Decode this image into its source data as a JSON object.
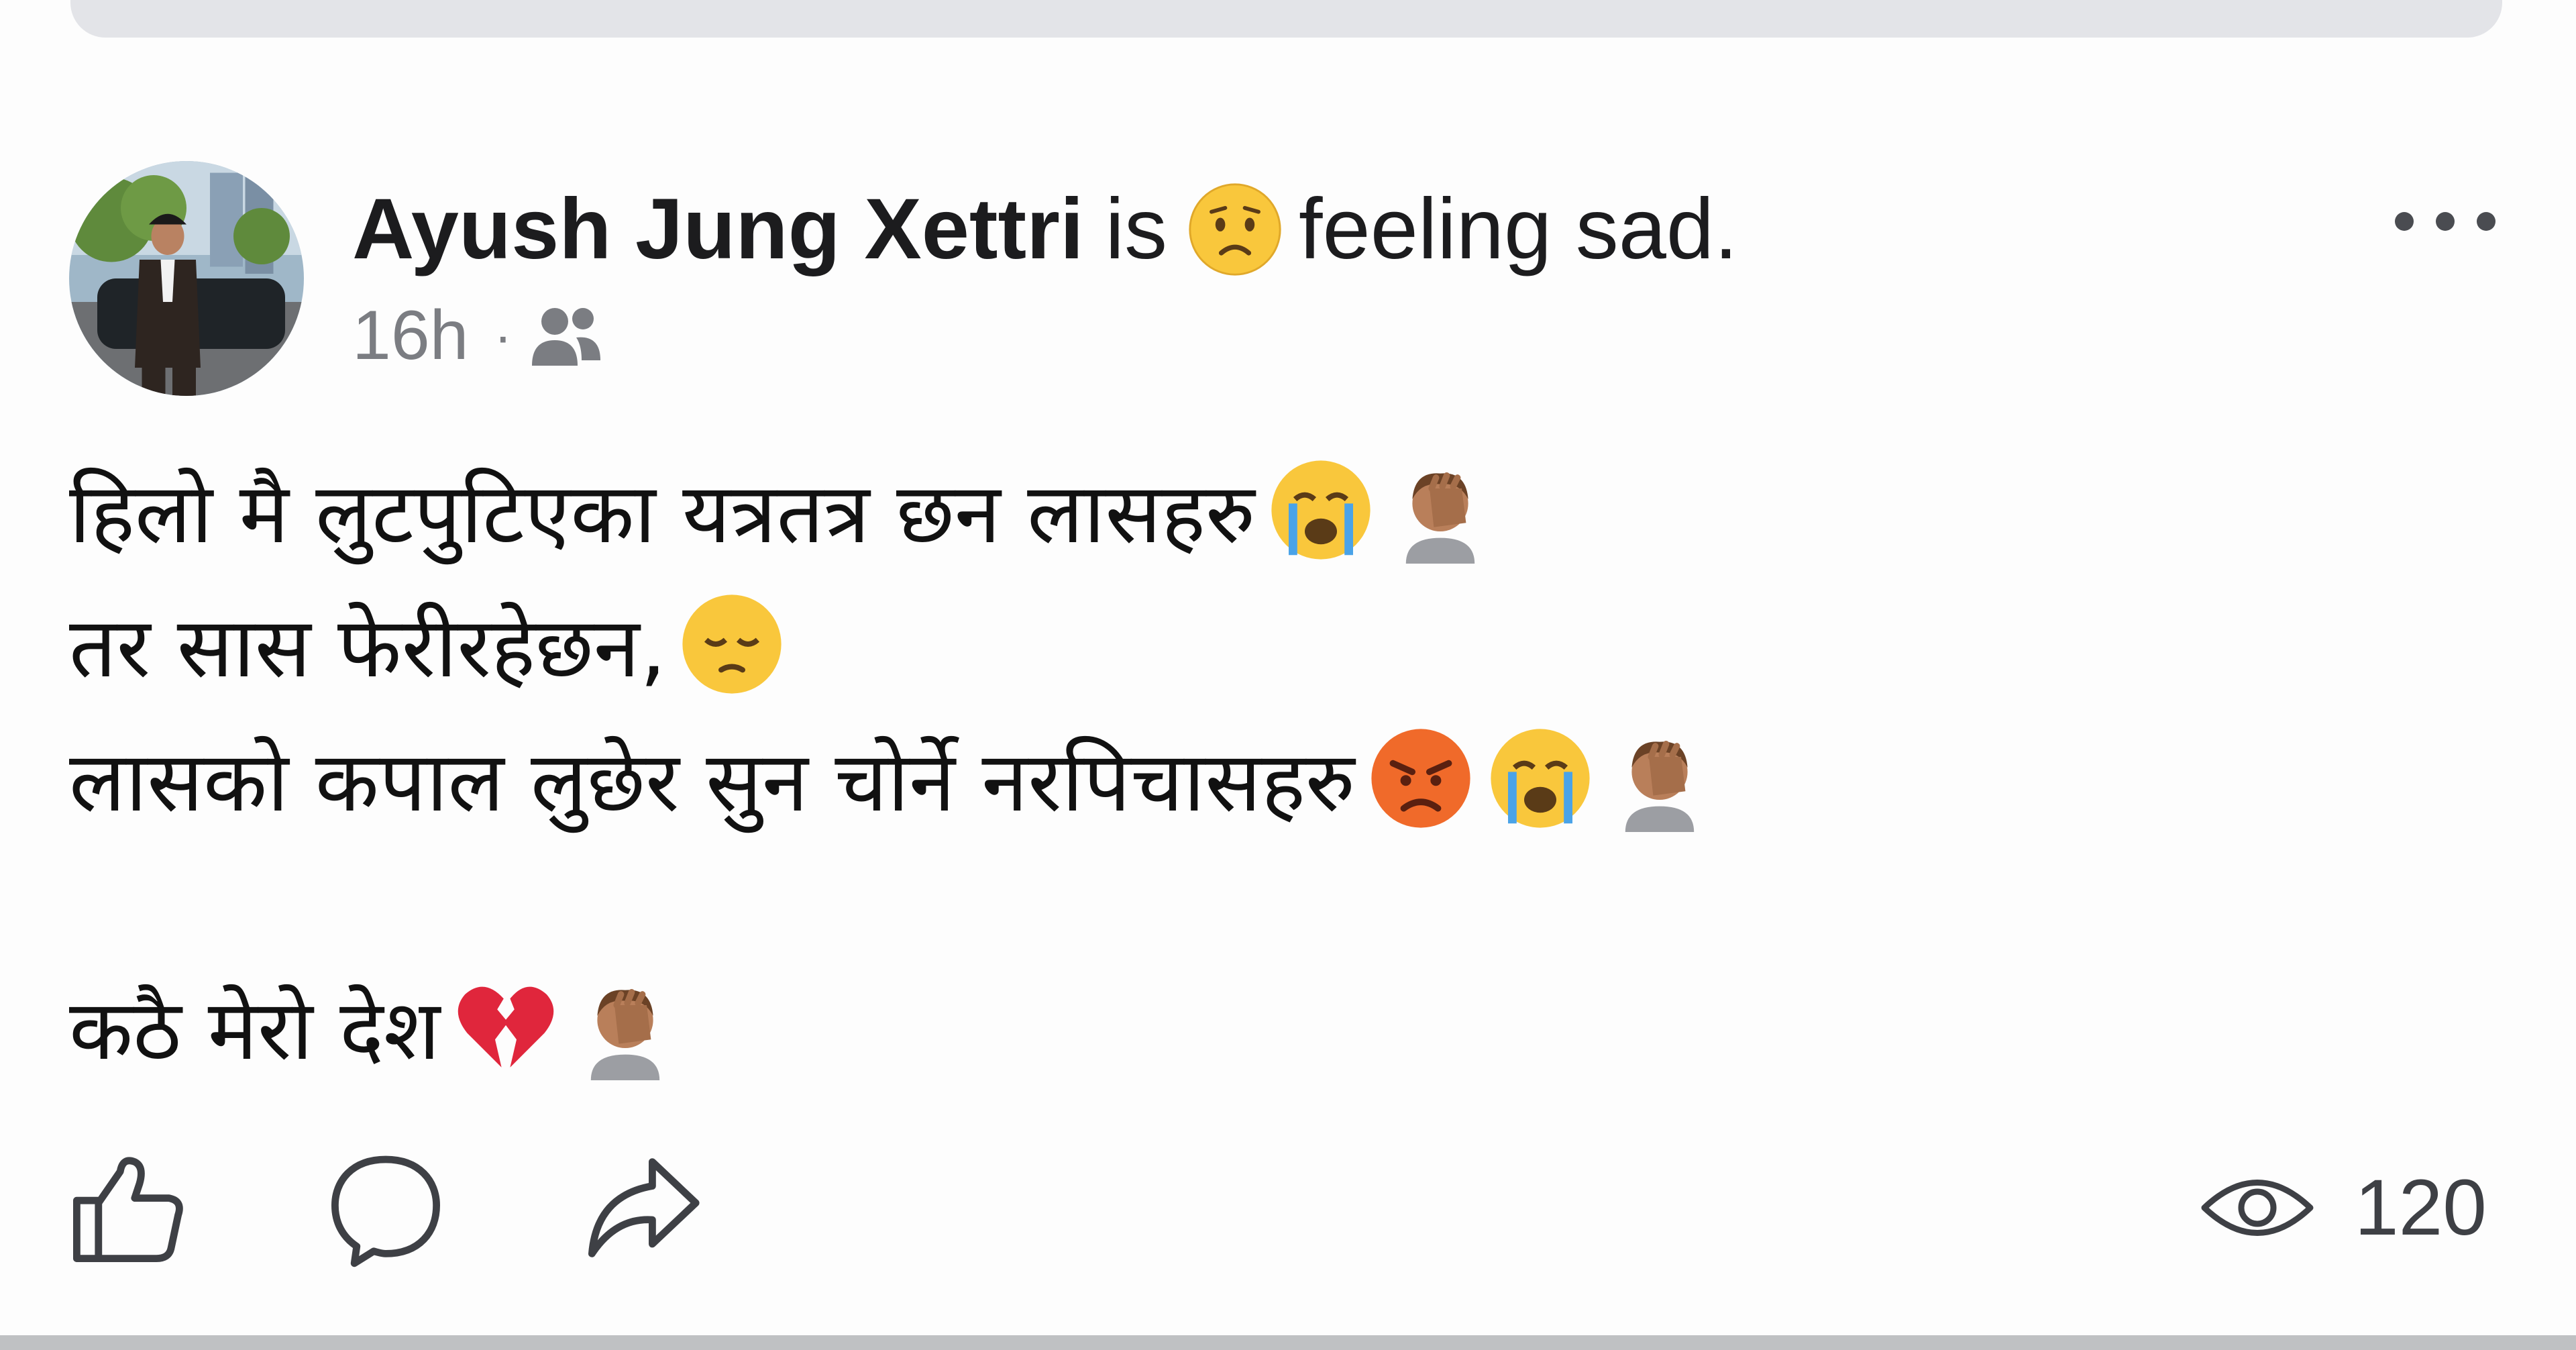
{
  "post": {
    "author": "Ayush Jung Xettri",
    "feeling_verb": "is",
    "feeling_icon": "worried-face-icon",
    "feeling_text": "feeling sad.",
    "time": "16h",
    "separator": "·",
    "audience_icon": "friends-icon",
    "lines": [
      {
        "text": "हिलो मै लुटपुटिएका यत्रतत्र छन लासहरु",
        "emojis": [
          "crying-face",
          "facepalm"
        ]
      },
      {
        "text": "तर सास फेरीरहेछन,",
        "emojis": [
          "pensive-face"
        ]
      },
      {
        "text": "लासको कपाल लुछेर सुन चोर्ने नरपिचासहरु",
        "emojis": [
          "angry-face",
          "crying-face",
          "facepalm"
        ]
      },
      {
        "text": "",
        "emojis": []
      },
      {
        "text": "कठै मेरो देश",
        "emojis": [
          "broken-heart",
          "facepalm"
        ]
      }
    ]
  },
  "actions": {
    "like_icon": "thumbs-up-icon",
    "comment_icon": "comment-icon",
    "share_icon": "share-icon",
    "views_icon": "eye-icon",
    "views_count": "120"
  },
  "colors": {
    "text": "#1c1c1e",
    "meta": "#7b7d82",
    "icon": "#3e4045",
    "top_bar": "#e3e4e8"
  }
}
